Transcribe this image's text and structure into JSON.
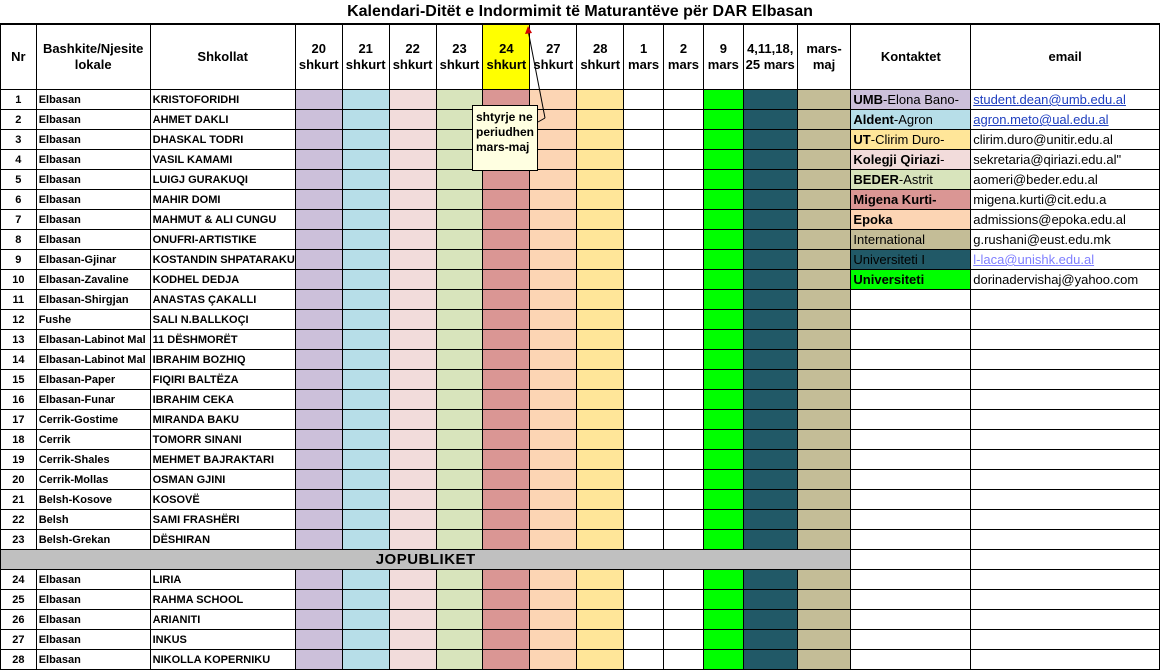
{
  "title": "Kalendari-Ditët e Indormimit të Maturantëve për DAR Elbasan",
  "headers": {
    "nr": "Nr",
    "bashkite": "Bashkite/Njesite lokale",
    "shkollat": "Shkollat",
    "dates": [
      {
        "day": "20",
        "month": "shkurt"
      },
      {
        "day": "21",
        "month": "shkurt"
      },
      {
        "day": "22",
        "month": "shkurt"
      },
      {
        "day": "23",
        "month": "shkurt"
      },
      {
        "day": "24",
        "month": "shkurt"
      },
      {
        "day": "27",
        "month": "shkurt"
      },
      {
        "day": "28",
        "month": "shkurt"
      },
      {
        "day": "1",
        "month": "mars"
      },
      {
        "day": "2",
        "month": "mars"
      },
      {
        "day": "9",
        "month": "mars"
      },
      {
        "day": "4,11,18,",
        "month": "25 mars"
      },
      {
        "day": "mars-",
        "month": "maj"
      }
    ],
    "kontaktet": "Kontaktet",
    "email": "email"
  },
  "column_colors": [
    "#ccc0da",
    "#b7dee8",
    "#f2dcdb",
    "#d8e4bc",
    "#da9694",
    "#fcd5b4",
    "#ffe699",
    "#ffffff",
    "#ffffff",
    "#00ff00",
    "#215967",
    "#c4bd97"
  ],
  "header_highlight_color": "#ffff00",
  "comment_note": "shtyrje ne periudhen mars-maj",
  "separator_label": "JOPUBLIKET",
  "rows": [
    {
      "nr": "1",
      "loc": "Elbasan",
      "school": "KRISTOFORIDHI"
    },
    {
      "nr": "2",
      "loc": "Elbasan",
      "school": "AHMET DAKLI"
    },
    {
      "nr": "3",
      "loc": "Elbasan",
      "school": "DHASKAL TODRI"
    },
    {
      "nr": "4",
      "loc": "Elbasan",
      "school": "VASIL KAMAMI"
    },
    {
      "nr": "5",
      "loc": "Elbasan",
      "school": "LUIGJ GURAKUQI"
    },
    {
      "nr": "6",
      "loc": "Elbasan",
      "school": "MAHIR DOMI"
    },
    {
      "nr": "7",
      "loc": "Elbasan",
      "school": "MAHMUT & ALI CUNGU"
    },
    {
      "nr": "8",
      "loc": "Elbasan",
      "school": "ONUFRI-ARTISTIKE"
    },
    {
      "nr": "9",
      "loc": "Elbasan-Gjinar",
      "school": "KOSTANDIN SHPATARAKU"
    },
    {
      "nr": "10",
      "loc": "Elbasan-Zavaline",
      "school": "KODHEL DEDJA"
    },
    {
      "nr": "11",
      "loc": "Elbasan-Shirgjan",
      "school": "ANASTAS ÇAKALLI"
    },
    {
      "nr": "12",
      "loc": "Fushe",
      "school": "SALI N.BALLKOÇI"
    },
    {
      "nr": "13",
      "loc": "Elbasan-Labinot Mal",
      "school": "11 DËSHMORËT"
    },
    {
      "nr": "14",
      "loc": "Elbasan-Labinot Mal",
      "school": "IBRAHIM BOZHIQ"
    },
    {
      "nr": "15",
      "loc": "Elbasan-Paper",
      "school": "FIQIRI BALTËZA"
    },
    {
      "nr": "16",
      "loc": "Elbasan-Funar",
      "school": "IBRAHIM CEKA"
    },
    {
      "nr": "17",
      "loc": "Cerrik-Gostime",
      "school": "MIRANDA BAKU"
    },
    {
      "nr": "18",
      "loc": "Cerrik",
      "school": "TOMORR SINANI"
    },
    {
      "nr": "19",
      "loc": "Cerrik-Shales",
      "school": "MEHMET BAJRAKTARI"
    },
    {
      "nr": "20",
      "loc": "Cerrik-Mollas",
      "school": "OSMAN GJINI"
    },
    {
      "nr": "21",
      "loc": "Belsh-Kosove",
      "school": "KOSOVË"
    },
    {
      "nr": "22",
      "loc": "Belsh",
      "school": "SAMI FRASHËRI"
    },
    {
      "nr": "23",
      "loc": "Belsh-Grekan",
      "school": "DËSHIRAN"
    }
  ],
  "private_rows": [
    {
      "nr": "24",
      "loc": "Elbasan",
      "school": "LIRIA"
    },
    {
      "nr": "25",
      "loc": "Elbasan",
      "school": "RAHMA SCHOOL"
    },
    {
      "nr": "26",
      "loc": "Elbasan",
      "school": "ARIANITI"
    },
    {
      "nr": "27",
      "loc": "Elbasan",
      "school": "INKUS"
    },
    {
      "nr": "28",
      "loc": "Elbasan",
      "school": "NIKOLLA KOPERNIKU"
    }
  ],
  "contacts": [
    {
      "bold": "UMB",
      "rest": "-Elona Bano-",
      "bg": "#ccc0da",
      "color": "#000000",
      "email": "student.dean@umb.edu.al",
      "link": true
    },
    {
      "bold": "Aldent",
      "rest": "-Agron",
      "bg": "#b7dee8",
      "color": "#000000",
      "email": "agron.meto@ual.edu.al",
      "link": true
    },
    {
      "bold": "UT",
      "rest": "-Clirim Duro-",
      "bg": "#ffe699",
      "color": "#000000",
      "email": "clirim.duro@unitir.edu.al",
      "link": false
    },
    {
      "bold": "Kolegji Qiriazi",
      "rest": "-",
      "bg": "#f2dcdb",
      "color": "#000000",
      "email": "sekretaria@qiriazi.edu.al\"",
      "link": false
    },
    {
      "bold": "BEDER",
      "rest": "-Astrit",
      "bg": "#d8e4bc",
      "color": "#000000",
      "email": "aomeri@beder.edu.al",
      "link": false
    },
    {
      "bold": "Migena Kurti-",
      "rest": "",
      "bg": "#da9694",
      "color": "#000000",
      "email": "migena.kurti@cit.edu.a",
      "link": false
    },
    {
      "bold": "Epoka",
      "rest": "",
      "bg": "#fcd5b4",
      "color": "#000000",
      "email": "admissions@epoka.edu.al",
      "link": false
    },
    {
      "bold": "",
      "rest": "International",
      "bg": "#c4bd97",
      "color": "#000000",
      "email": "g.rushani@eust.edu.mk",
      "link": false
    },
    {
      "bold": "",
      "rest": "Universiteti I",
      "bg": "#215967",
      "color": "#000000",
      "email": "l-laca@unishk.edu.al",
      "link": true,
      "email_on_dark": true
    },
    {
      "bold": "Universiteti",
      "rest": "",
      "bg": "#00ff00",
      "color": "#000000",
      "email": "dorinadervishaj@yahoo.com",
      "link": false
    }
  ]
}
